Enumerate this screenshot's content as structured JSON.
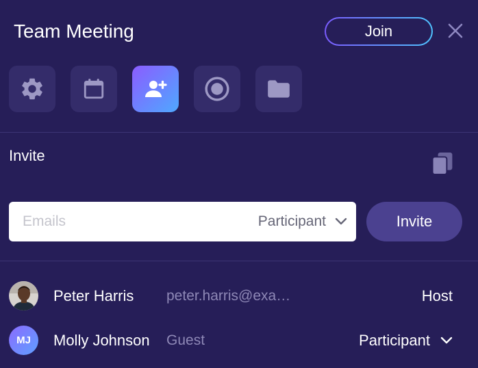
{
  "header": {
    "title": "Team Meeting",
    "join_label": "Join"
  },
  "tools": [
    {
      "name": "settings",
      "icon": "gear-icon",
      "active": false
    },
    {
      "name": "calendar",
      "icon": "calendar-icon",
      "active": false
    },
    {
      "name": "invite",
      "icon": "add-user-icon",
      "active": true
    },
    {
      "name": "record",
      "icon": "record-icon",
      "active": false
    },
    {
      "name": "files",
      "icon": "folder-icon",
      "active": false
    }
  ],
  "invite": {
    "section_label": "Invite",
    "email_placeholder": "Emails",
    "email_value": "",
    "role_selected": "Participant",
    "invite_button": "Invite"
  },
  "members": [
    {
      "name": "Peter Harris",
      "meta": "peter.harris@exa…",
      "role": "Host",
      "avatar": "photo"
    },
    {
      "name": "Molly Johnson",
      "meta": "Guest",
      "role": "Participant",
      "avatar_initials": "MJ"
    }
  ],
  "colors": {
    "background": "#261e58",
    "tile": "#342c6a",
    "accent_start": "#8b5cff",
    "accent_end": "#4fa8ff",
    "invite_button": "#4b4190",
    "muted_text": "#8e88b6"
  }
}
